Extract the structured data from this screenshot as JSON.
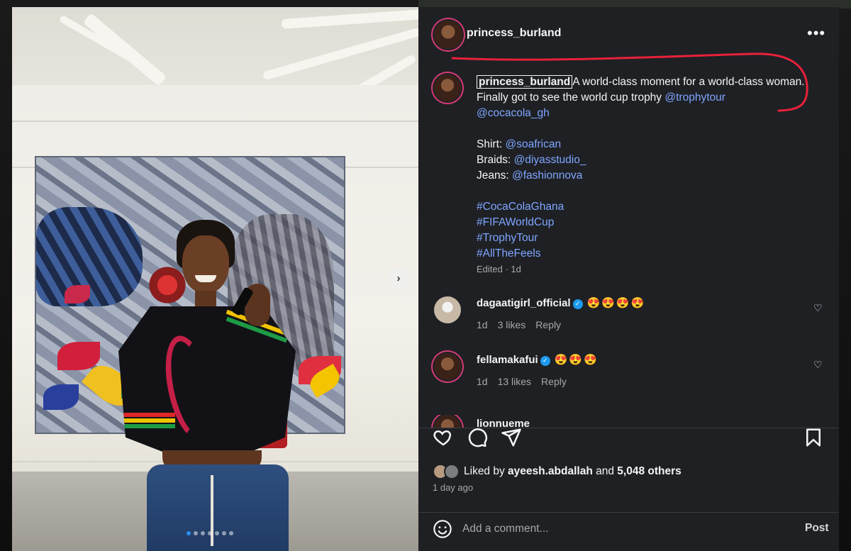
{
  "post": {
    "author": "princess_burland",
    "more_label": "•••",
    "caption": {
      "username": "princess_burland",
      "text_1": "A world-class moment for a world-class woman. Finally got to see the world cup trophy ",
      "mention_trophy": "@trophytour",
      "mention_coke": "@cocacola_gh",
      "shirt_label": "Shirt: ",
      "shirt_mention": "@soafrican",
      "braids_label": "Braids: ",
      "braids_mention": "@diyasstudio_",
      "jeans_label": "Jeans: ",
      "jeans_mention": "@fashionnova",
      "hashtags": [
        "#CocaColaGhana",
        "#FIFAWorldCup",
        "#TrophyTour",
        "#AllTheFeels"
      ],
      "edited": "Edited · 1d"
    },
    "comments": [
      {
        "username": "dagaatigirl_official",
        "verified": true,
        "text": "😍😍😍😍",
        "time": "1d",
        "likes": "3 likes",
        "reply": "Reply"
      },
      {
        "username": "fellamakafui",
        "verified": true,
        "text": "😍😍😍",
        "time": "1d",
        "likes": "13 likes",
        "reply": "Reply"
      },
      {
        "username": "lionnueme",
        "verified": true,
        "text": ""
      }
    ],
    "liked_by_prefix": "Liked by ",
    "liked_by_user": "ayeesh.abdallah",
    "liked_by_suffix": " and ",
    "liked_by_others": "5,048 others",
    "time_ago": "1 day ago",
    "add_comment_placeholder": "Add a comment...",
    "post_label": "Post"
  },
  "carousel": {
    "next_label": "›",
    "slide_count": 7,
    "active_index": 0
  },
  "colors": {
    "link": "#7fa6ff",
    "panel_bg": "#1e2024",
    "annotation_red": "#e8213a",
    "verified": "#1d9bf0"
  }
}
